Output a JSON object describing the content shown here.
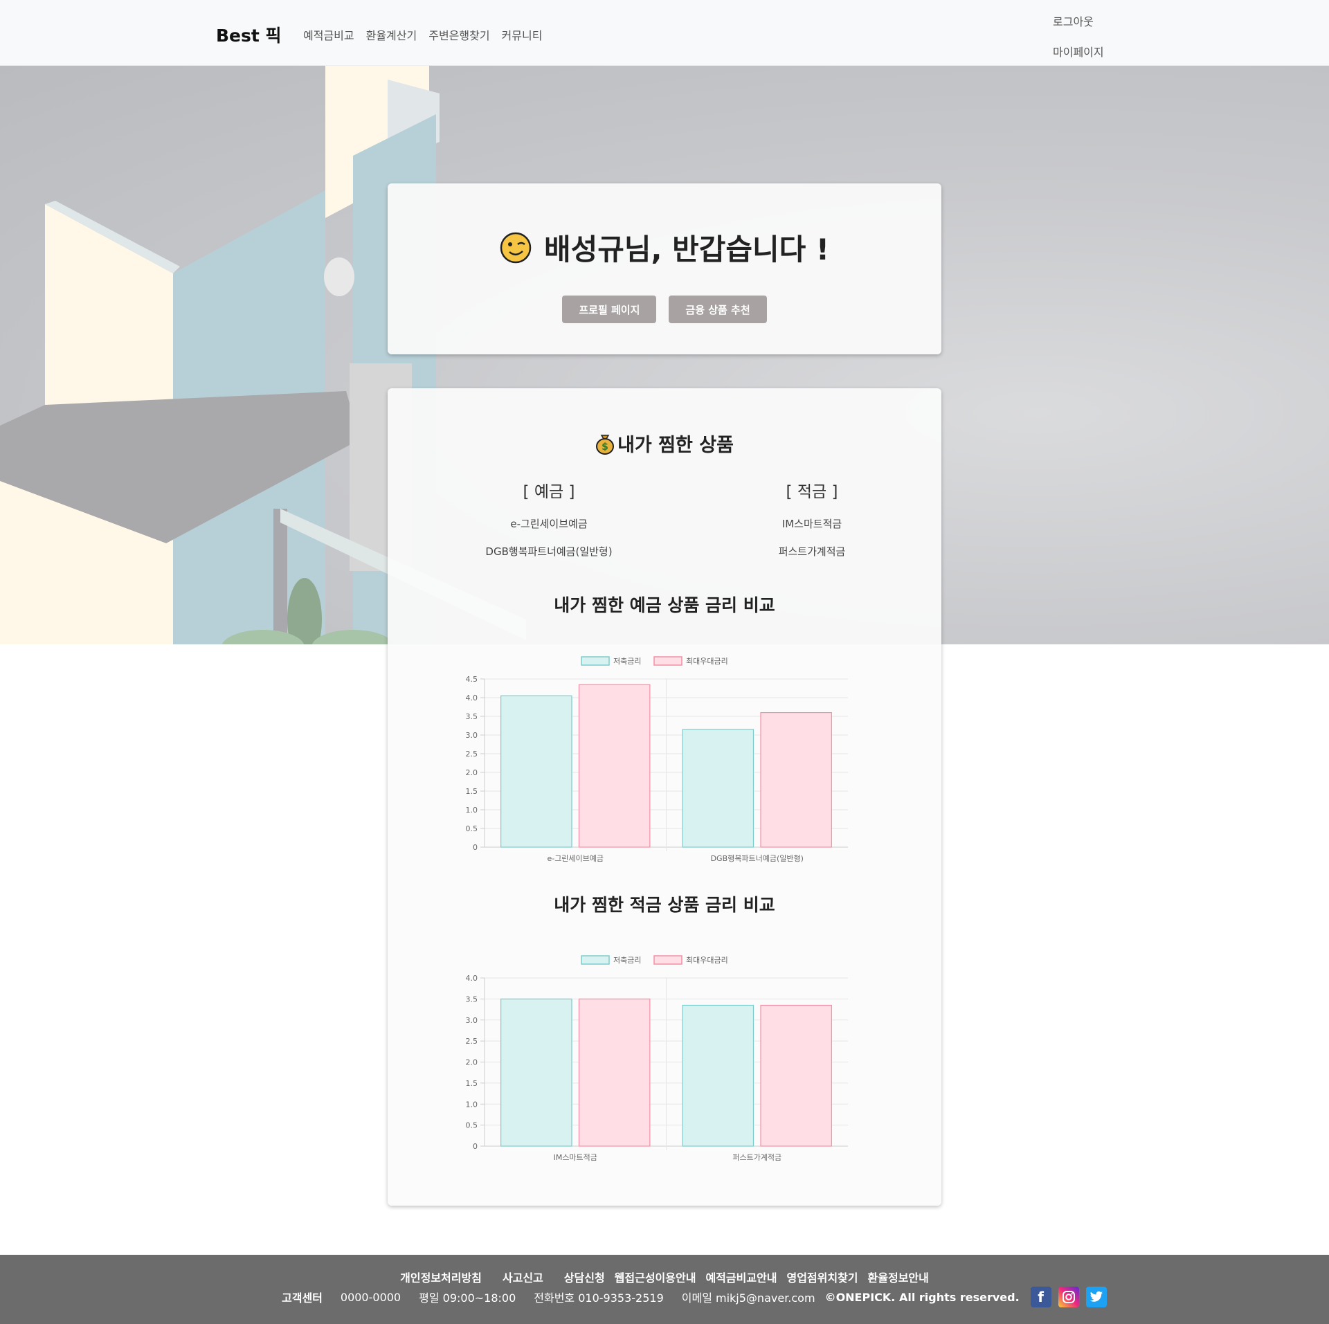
{
  "navbar": {
    "brand": "Best 픽",
    "links": [
      "예적금비교",
      "환율계산기",
      "주변은행찾기",
      "커뮤니티"
    ],
    "logout": "로그아웃",
    "mypage": "마이페이지"
  },
  "welcome": {
    "title": "배성규님, 반갑습니다 !",
    "emoji_icon": "winking-face-icon",
    "profile_button": "프로필 페이지",
    "recommend_button": "금융 상품 추천"
  },
  "favorites": {
    "title": "내가 찜한 상품",
    "icon": "money-bag-icon",
    "deposit_heading": "[ 예금 ]",
    "deposit_items": [
      "e-그린세이브예금",
      "DGB행복파트너예금(일반형)"
    ],
    "savings_heading": "[ 적금 ]",
    "savings_items": [
      "IM스마트적금",
      "퍼스트가계적금"
    ]
  },
  "chart_titles": {
    "deposit": "내가 찜한 예금 상품 금리 비교",
    "savings": "내가 찜한 적금 상품 금리 비교"
  },
  "chart_data": [
    {
      "type": "bar",
      "categories": [
        "e-그린세이브예금",
        "DGB행복파트너예금(일반형)"
      ],
      "series": [
        {
          "name": "저축금리",
          "values": [
            4.05,
            3.15
          ],
          "color": "#d8f1f1",
          "border": "#7ccdcd"
        },
        {
          "name": "최대우대금리",
          "values": [
            4.35,
            3.6
          ],
          "color": "#ffdfe5",
          "border": "#f38fa6"
        }
      ],
      "ylim": [
        0,
        4.5
      ],
      "yticks": [
        "0",
        "0.5",
        "1.0",
        "1.5",
        "2.0",
        "2.5",
        "3.0",
        "3.5",
        "4.0",
        "4.5"
      ],
      "legend": "top",
      "grid": true
    },
    {
      "type": "bar",
      "categories": [
        "IM스마트적금",
        "퍼스트가계적금"
      ],
      "series": [
        {
          "name": "저축금리",
          "values": [
            3.5,
            3.35
          ],
          "color": "#d8f1f1",
          "border": "#7ccdcd"
        },
        {
          "name": "최대우대금리",
          "values": [
            3.5,
            3.35
          ],
          "color": "#ffdfe5",
          "border": "#f38fa6"
        }
      ],
      "ylim": [
        0,
        4.0
      ],
      "yticks": [
        "0",
        "0.5",
        "1.0",
        "1.5",
        "2.0",
        "2.5",
        "3.0",
        "3.5",
        "4.0"
      ],
      "legend": "top",
      "grid": true
    }
  ],
  "footer": {
    "links": [
      "개인정보처리방침",
      "사고신고",
      "상담신청",
      "웹접근성이용안내",
      "예적금비교안내",
      "영업점위치찾기",
      "환율정보안내"
    ],
    "center_label": "고객센터",
    "center_number": "0000-0000",
    "hours": "평일 09:00~18:00",
    "phone": "전화번호 010-9353-2519",
    "email": "이메일 mikj5@naver.com",
    "copyright": "©ONEPICK. All rights reserved.",
    "social_icons": [
      "facebook-icon",
      "instagram-icon",
      "twitter-icon"
    ]
  }
}
